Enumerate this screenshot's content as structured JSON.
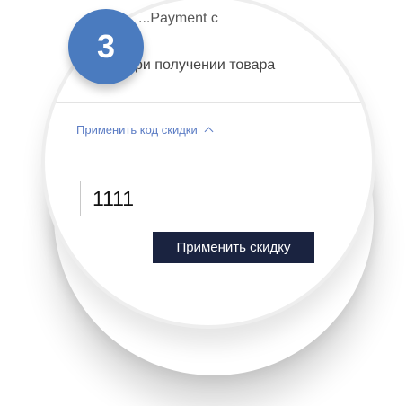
{
  "header": {
    "partial_text": "...Payment с"
  },
  "payment": {
    "partial_text": "а при получении товара"
  },
  "discount": {
    "toggle_label": "Применить код скидки",
    "code_value": "1111",
    "apply_label": "Применить скидку"
  },
  "badge": {
    "number": "3",
    "color": "#4a7bbf"
  },
  "colors": {
    "accent": "#5b7cc4",
    "button": "#1a2340"
  },
  "icons": {
    "caret": "chevron-up-icon"
  }
}
